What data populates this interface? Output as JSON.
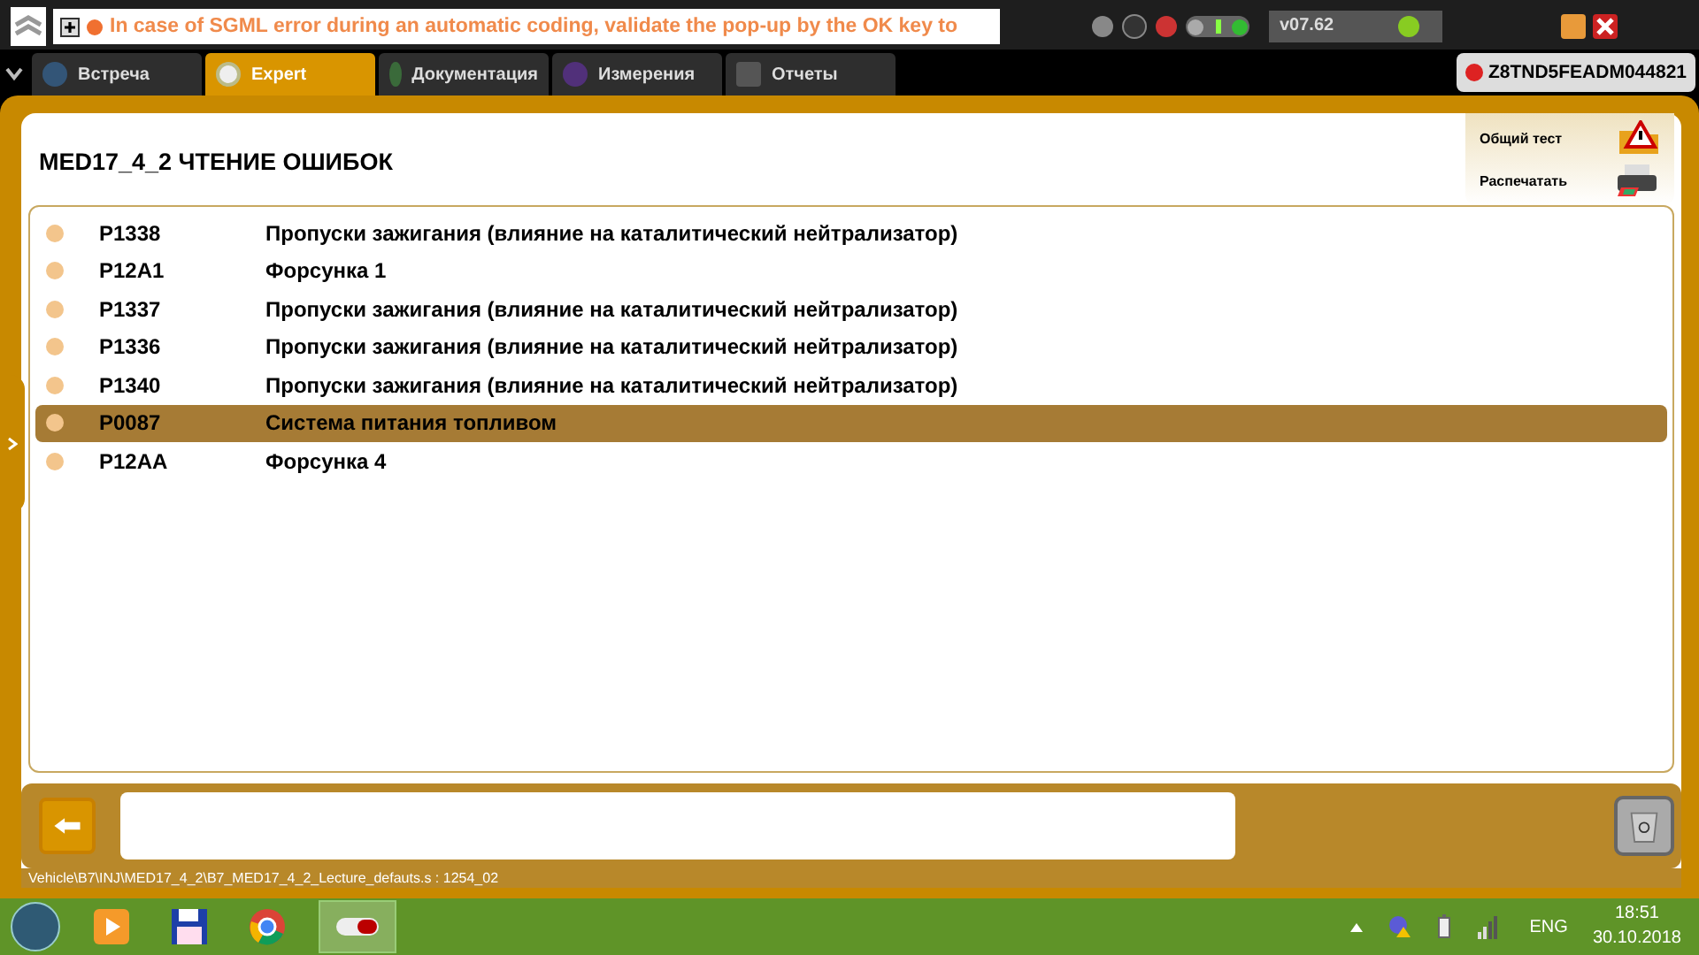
{
  "banner": {
    "message": "In case of SGML error during an automatic coding, validate the pop-up by the OK key to"
  },
  "toolbar": {
    "version": "v07.62"
  },
  "tabs": [
    {
      "label": "Встреча",
      "selected": false
    },
    {
      "label": "Expert",
      "selected": true
    },
    {
      "label": "Документация",
      "selected": false
    },
    {
      "label": "Измерения",
      "selected": false
    },
    {
      "label": "Отчеты",
      "selected": false
    }
  ],
  "vin": "Z8TND5FEADM044821",
  "page_title": "MED17_4_2  ЧТЕНИЕ ОШИБОК",
  "actions": [
    {
      "label": "Общий тест",
      "kind": "test"
    },
    {
      "label": "Распечатать",
      "kind": "print"
    }
  ],
  "faults": [
    {
      "code": "P1338",
      "description": "Пропуски зажигания (влияние на каталитический нейтрализатор)",
      "selected": false
    },
    {
      "code": "P12A1",
      "description": "Форсунка 1",
      "selected": false
    },
    {
      "code": "P1337",
      "description": "Пропуски зажигания (влияние на каталитический нейтрализатор)",
      "selected": false
    },
    {
      "code": "P1336",
      "description": "Пропуски зажигания (влияние на каталитический нейтрализатор)",
      "selected": false
    },
    {
      "code": "P1340",
      "description": "Пропуски зажигания (влияние на каталитический нейтрализатор)",
      "selected": false
    },
    {
      "code": "P0087",
      "description": "Система питания топливом",
      "selected": true
    },
    {
      "code": "P12AA",
      "description": "Форсунка 4",
      "selected": false
    }
  ],
  "status_path": "Vehicle\\B7\\INJ\\MED17_4_2\\B7_MED17_4_2_Lecture_defauts.s : 1254_02",
  "taskbar": {
    "language": "ENG",
    "time": "18:51",
    "date": "30.10.2018"
  }
}
